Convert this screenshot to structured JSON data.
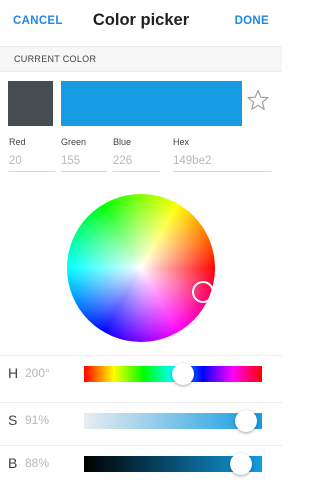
{
  "header": {
    "cancel_label": "CANCEL",
    "title": "Color picker",
    "done_label": "DONE"
  },
  "current_color": {
    "section_label": "CURRENT COLOR",
    "old_swatch_color": "#474c52",
    "new_swatch_color": "#149be2",
    "star_icon": "star-outline-icon"
  },
  "fields": {
    "red": {
      "label": "Red",
      "value": "20"
    },
    "green": {
      "label": "Green",
      "value": "155"
    },
    "blue": {
      "label": "Blue",
      "value": "226"
    },
    "hex": {
      "label": "Hex",
      "value": "149be2"
    }
  },
  "sliders": {
    "hue": {
      "letter": "H",
      "value_text": "200°",
      "value": 200,
      "max": 360
    },
    "saturation": {
      "letter": "S",
      "value_text": "91%",
      "value": 91,
      "max": 100
    },
    "brightness": {
      "letter": "B",
      "value_text": "88%",
      "value": 88,
      "max": 100
    }
  }
}
